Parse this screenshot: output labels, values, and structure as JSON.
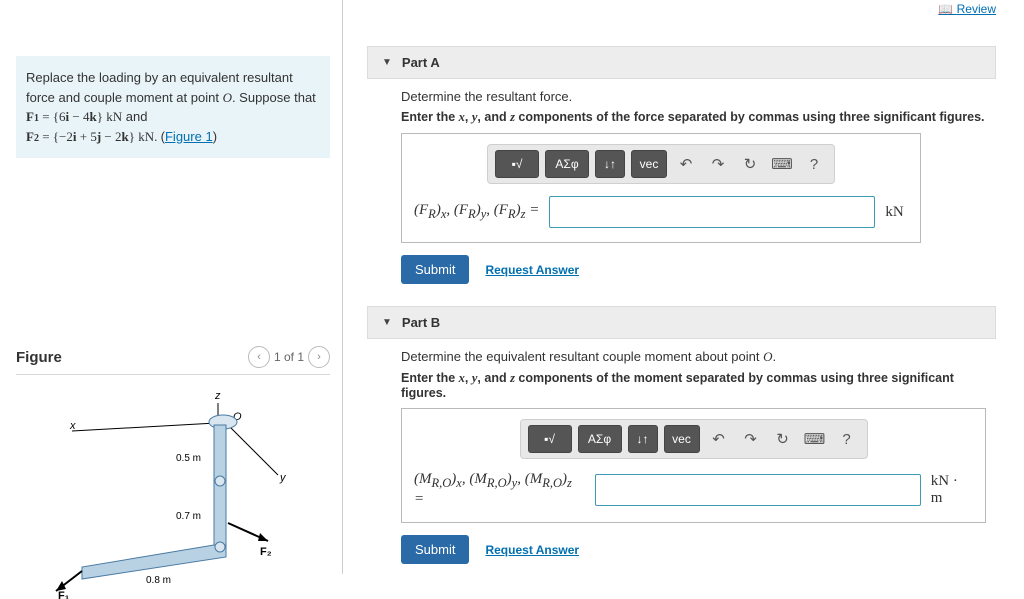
{
  "review_label": "Review",
  "intro": {
    "line1": "Replace the loading by an equivalent resultant force and couple moment at point ",
    "pointO": "O",
    "line1b": ". Suppose that",
    "F1": "F₁ = {6i − 4k} kN",
    "and": " and",
    "F2": "F₂ = {−2i + 5j − 2k} kN. ",
    "figref": "(Figure 1)"
  },
  "figure": {
    "title": "Figure",
    "page": "1 of 1",
    "dims": {
      "a": "0.5 m",
      "b": "0.7 m",
      "c": "0.8 m"
    },
    "axes": {
      "x": "x",
      "y": "y",
      "z": "z",
      "O": "O"
    },
    "forces": {
      "F1": "F₁",
      "F2": "F₂"
    }
  },
  "partA": {
    "title": "Part A",
    "prompt": "Determine the resultant force.",
    "hint_pre": "Enter the ",
    "hint_xyz": "x, y, and z",
    "hint_post": " components of the force separated by commas using three significant figures.",
    "var": "(F_R)_x, (F_R)_y, (F_R)_z =",
    "unit": "kN",
    "input_width": 326
  },
  "partB": {
    "title": "Part B",
    "prompt_pre": "Determine the equivalent resultant couple moment about point ",
    "prompt_O": "O",
    "prompt_post": ".",
    "hint_pre": "Enter the ",
    "hint_xyz": "x, y, and z",
    "hint_post": " components of the moment separated by commas using three significant figures.",
    "var": "(M_{R,O})_x, (M_{R,O})_y, (M_{R,O})_z =",
    "unit": "kN · m",
    "input_width": 326
  },
  "toolbar": {
    "sqrt": "√",
    "greek": "ΑΣφ",
    "sup": "↓↑",
    "vec": "vec",
    "undo": "↶",
    "redo": "↷",
    "reset": "↻",
    "keyboard": "⌨",
    "help": "?"
  },
  "submit": "Submit",
  "request": "Request Answer"
}
